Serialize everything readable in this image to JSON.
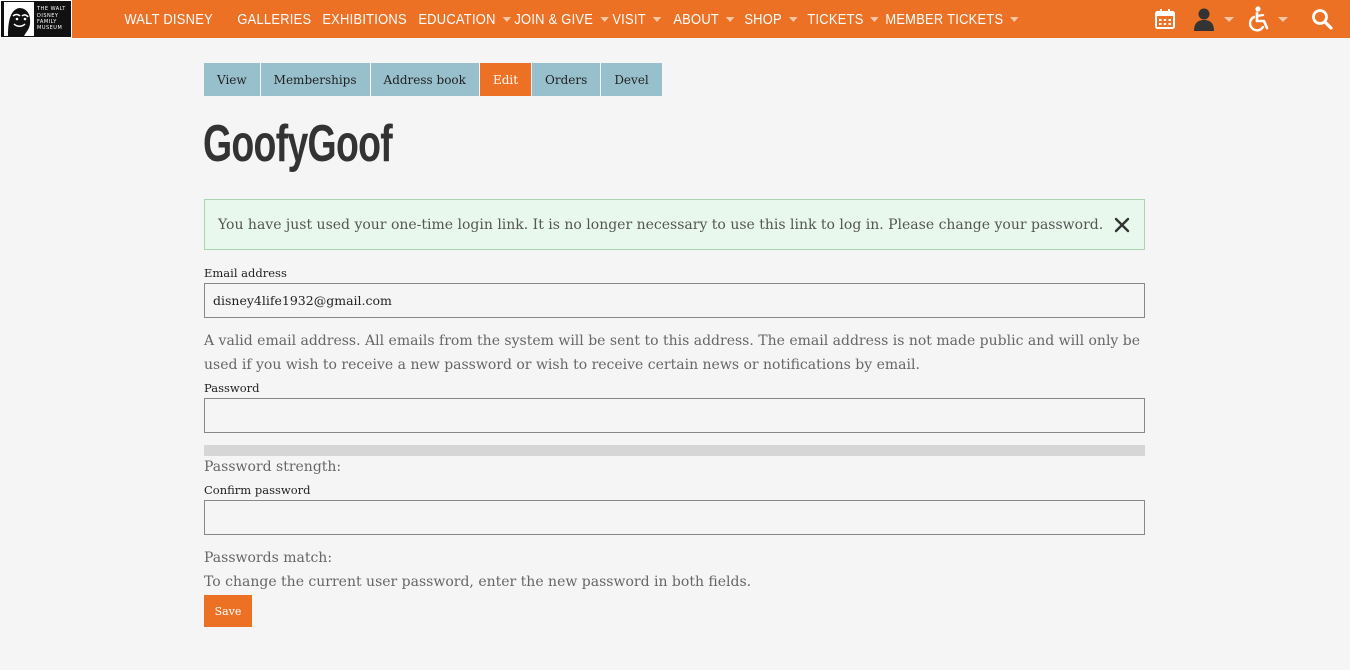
{
  "logo": {
    "lines": [
      "THE WALT",
      "DISNEY",
      "FAMILY",
      "MUSEUM"
    ]
  },
  "nav": {
    "items": [
      {
        "label": "WALT DISNEY",
        "caret": false
      },
      {
        "label": "GALLERIES",
        "caret": false
      },
      {
        "label": "EXHIBITIONS",
        "caret": false
      },
      {
        "label": "EDUCATION",
        "caret": true
      },
      {
        "label": "JOIN & GIVE",
        "caret": true
      },
      {
        "label": "VISIT",
        "caret": true
      },
      {
        "label": "ABOUT",
        "caret": true
      },
      {
        "label": "SHOP",
        "caret": true
      },
      {
        "label": "TICKETS",
        "caret": true
      },
      {
        "label": "MEMBER TICKETS",
        "caret": true
      }
    ],
    "icons": [
      "calendar-icon",
      "user-icon",
      "accessibility-icon",
      "search-icon"
    ]
  },
  "tabs": [
    {
      "label": "View",
      "active": false
    },
    {
      "label": "Memberships",
      "active": false
    },
    {
      "label": "Address book",
      "active": false
    },
    {
      "label": "Edit",
      "active": true
    },
    {
      "label": "Orders",
      "active": false
    },
    {
      "label": "Devel",
      "active": false
    }
  ],
  "page": {
    "title": "GoofyGoof"
  },
  "message": {
    "text": "You have just used your one-time login link. It is no longer necessary to use this link to log in. Please change your password."
  },
  "form": {
    "email_label": "Email address",
    "email_value": "disney4life1932@gmail.com",
    "email_help": "A valid email address. All emails from the system will be sent to this address. The email address is not made public and will only be used if you wish to receive a new password or wish to receive certain news or notifications by email.",
    "password_label": "Password",
    "password_value": "",
    "strength_label": "Password strength:",
    "strength_value": 0,
    "confirm_label": "Confirm password",
    "confirm_value": "",
    "match_label": "Passwords match:",
    "password_help": "To change the current user password, enter the new password in both fields.",
    "save_label": "Save"
  },
  "colors": {
    "brand": "#ed7125",
    "tab": "#98bfcc",
    "message_bg": "#e8f8ec"
  }
}
